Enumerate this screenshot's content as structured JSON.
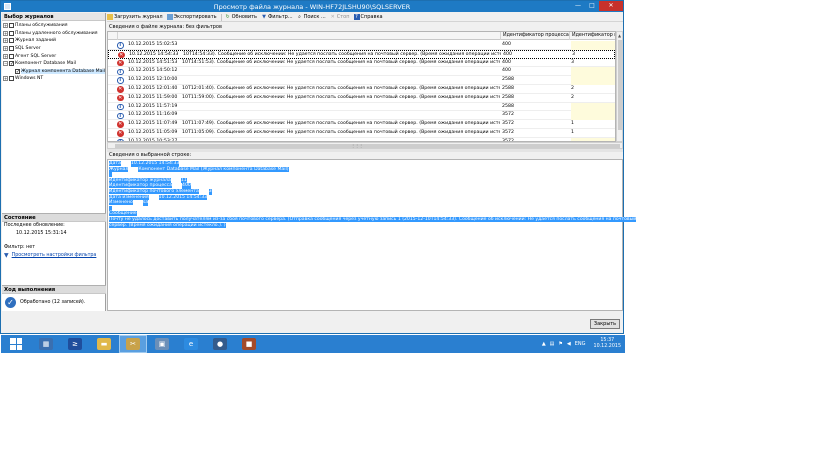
{
  "window": {
    "title": "Просмотр файла журнала - WIN-HF72JLSHU90\\SQLSERVER",
    "minimize_glyph": "—",
    "maximize_glyph": "□",
    "close_glyph": "✕"
  },
  "left": {
    "header": "Выбор журналов",
    "tree": [
      {
        "label": "Планы обслуживания",
        "expander": "+",
        "checked": false,
        "indent": 0
      },
      {
        "label": "Планы удаленного обслуживания",
        "expander": "+",
        "checked": false,
        "indent": 0
      },
      {
        "label": "Журнал заданий",
        "expander": "+",
        "checked": false,
        "indent": 0
      },
      {
        "label": "SQL Server",
        "expander": "+",
        "checked": false,
        "indent": 0
      },
      {
        "label": "Агент SQL Server",
        "expander": "+",
        "checked": false,
        "indent": 0
      },
      {
        "label": "Компонент Database Mail",
        "expander": "−",
        "checked": true,
        "indent": 0
      },
      {
        "label": "Журнал компонента Database Mail",
        "expander": "",
        "checked": true,
        "indent": 1
      },
      {
        "label": "Windows NT",
        "expander": "+",
        "checked": false,
        "indent": 0
      }
    ],
    "status_title": "Состояние",
    "last_update_label": "Последнее обновление:",
    "last_update_value": "10.12.2015 15:31:14",
    "filter_label": "Фильтр: нет",
    "filter_link": "Просмотреть настройки фильтра",
    "progress_title": "Ход выполнения",
    "progress_text": "Обработано (12 записей)."
  },
  "toolbar": {
    "load": "Загрузить журнал",
    "export": "Экспортировать",
    "refresh": "Обновить",
    "filter": "Фильтр...",
    "search": "Поиск ...",
    "stop": "Стоп",
    "help": "Справка"
  },
  "grid": {
    "info": "Сведения о файле журнала: без фильтров",
    "columns": [
      "",
      "",
      "Идентификатор процесса",
      "Идентификатор почт"
    ],
    "rows": [
      {
        "icon": "info",
        "date": "10.12.2015 15:02:53",
        "message": "",
        "pid": "400",
        "mailid": ""
      },
      {
        "icon": "err",
        "date": "10.12.2015 14:54:33",
        "message": "10T14:54:33). Сообщение об исключении: Не удается послать сообщения на почтовый сервер. (Время ожидания операции истекло.). )",
        "pid": "400",
        "mailid": "3"
      },
      {
        "icon": "err",
        "date": "10.12.2015 14:51:53",
        "message": "10T14:51:53). Сообщение об исключении: Не удается послать сообщения на почтовый сервер. (Время ожидания операции истекло.). )",
        "pid": "400",
        "mailid": "3"
      },
      {
        "icon": "info",
        "date": "10.12.2015 14:50:12",
        "message": "",
        "pid": "400",
        "mailid": ""
      },
      {
        "icon": "info",
        "date": "10.12.2015 12:10:00",
        "message": "",
        "pid": "2588",
        "mailid": ""
      },
      {
        "icon": "err",
        "date": "10.12.2015 12:01:40",
        "message": "10T12:01:40). Сообщение об исключении: Не удается послать сообщения на почтовый сервер. (Время ожидания операции истекло.). )",
        "pid": "2588",
        "mailid": "2"
      },
      {
        "icon": "err",
        "date": "10.12.2015 11:59:00",
        "message": "10T11:59:00). Сообщение об исключении: Не удается послать сообщения на почтовый сервер. (Время ожидания операции истекло.). )",
        "pid": "2588",
        "mailid": "2"
      },
      {
        "icon": "info",
        "date": "10.12.2015 11:57:19",
        "message": "",
        "pid": "2588",
        "mailid": ""
      },
      {
        "icon": "info",
        "date": "10.12.2015 11:16:09",
        "message": "",
        "pid": "3572",
        "mailid": ""
      },
      {
        "icon": "err",
        "date": "10.12.2015 11:07:49",
        "message": "10T11:07:49). Сообщение об исключении: Не удается послать сообщения на почтовый сервер. (Время ожидания операции истекло.). )",
        "pid": "3572",
        "mailid": "1"
      },
      {
        "icon": "err",
        "date": "10.12.2015 11:05:09",
        "message": "10T11:05:09). Сообщение об исключении: Не удается послать сообщения на почтовый сервер. (Время ожидания операции истекло.). )",
        "pid": "3572",
        "mailid": "1"
      },
      {
        "icon": "info",
        "date": "10.12.2015 10:53:27",
        "message": "",
        "pid": "3572",
        "mailid": ""
      }
    ]
  },
  "details": {
    "label": "Сведения о выбранной строке:",
    "lines": [
      {
        "k": "Дата",
        "v": "10.12.2015 14:54:33"
      },
      {
        "k": "Журнал",
        "v": "Компонент Database Mail (Журнал компонента Database Mail)"
      },
      {
        "k": "",
        "v": ""
      },
      {
        "k": "Идентификатор журнала",
        "v": "11"
      },
      {
        "k": "Идентификатор процесса",
        "v": "400"
      },
      {
        "k": "Идентификатор почтового элемента",
        "v": "3"
      },
      {
        "k": "Дата изменения",
        "v": "10.12.2015 14:54:33"
      },
      {
        "k": "Изменено",
        "v": "sa"
      },
      {
        "k": "",
        "v": ""
      },
      {
        "k": "Сообщение",
        "v": ""
      },
      {
        "k": "Почту не удалось доставить получателям из-за сбоя почтового сервера. (Отправка сообщения через учетную запись 1 (2015-12-10T14:54:33). Сообщение об исключении: Не удается послать сообщения на почтовый",
        "v": ""
      },
      {
        "k": "сервер. (Время ожидания операции истекло.). )",
        "v": ""
      }
    ],
    "close_button": "Закрыть"
  },
  "taskbar": {
    "apps": [
      {
        "name": "server-manager",
        "glyph": "▦",
        "color": "#3a6fb0",
        "active": false
      },
      {
        "name": "powershell",
        "glyph": "≥",
        "color": "#1f4e9c",
        "active": false
      },
      {
        "name": "file-explorer",
        "glyph": "▬",
        "color": "#e0b84a",
        "active": false
      },
      {
        "name": "ssms",
        "glyph": "✂",
        "color": "#c8a24a",
        "active": true
      },
      {
        "name": "remote-desktop",
        "glyph": "▣",
        "color": "#6b8fb8",
        "active": false
      },
      {
        "name": "internet-explorer",
        "glyph": "e",
        "color": "#2d8be0",
        "active": false
      },
      {
        "name": "thunderbird",
        "glyph": "●",
        "color": "#345b8c",
        "active": false
      },
      {
        "name": "package-app",
        "glyph": "■",
        "color": "#a34a2a",
        "active": false
      }
    ],
    "lang": "ENG",
    "time": "15:37",
    "date": "10.12.2015"
  }
}
